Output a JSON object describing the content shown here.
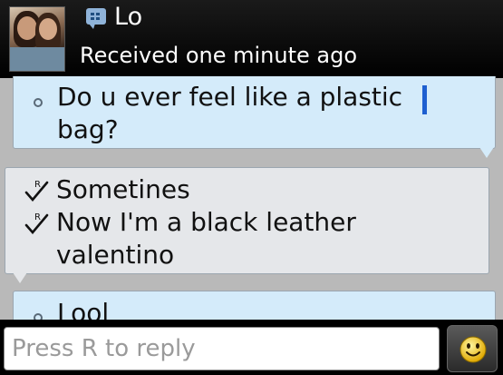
{
  "header": {
    "contact_name": "Lo",
    "status": "Received one minute ago"
  },
  "messages": [
    {
      "direction": "incoming",
      "text_line1": "Do u ever feel like a plastic",
      "text_line2": "bag?"
    },
    {
      "direction": "outgoing",
      "lines": [
        {
          "status": "read",
          "text": "Sometines"
        },
        {
          "status": "read",
          "text_line1": "Now I'm a black leather",
          "text_line2": "valentino"
        }
      ]
    },
    {
      "direction": "incoming",
      "text": "Lool"
    }
  ],
  "reply": {
    "placeholder": "Press R to reply",
    "emoticon_icon": "smiley-icon"
  },
  "colors": {
    "incoming_bubble": "#d4ebfa",
    "outgoing_bubble": "#e5e7ea",
    "cursor": "#1e5fd0"
  }
}
